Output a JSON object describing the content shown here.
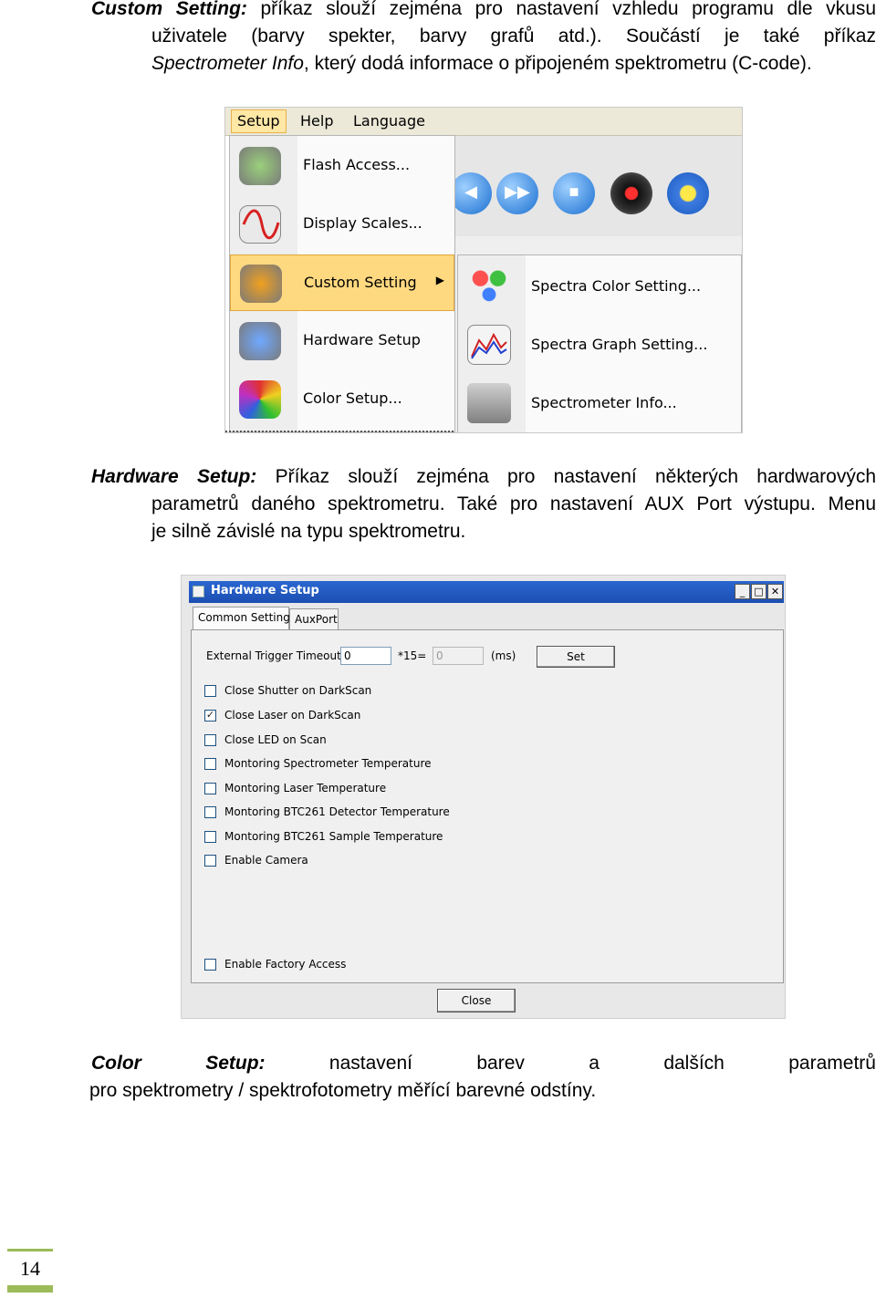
{
  "para1": {
    "lead": "Custom Setting:",
    "line1": "příkaz slouží zejména pro nastavení vzhledu programu dle vkusu",
    "line2": "uživatele (barvy spekter, barvy grafů atd.). Součástí je také příkaz",
    "line3_ital": "Spectrometer Info",
    "line3_rest": ", který dodá informace o připojeném spektrometru (C-code)."
  },
  "menu_shot": {
    "menubar": [
      "Setup",
      "Help",
      "Language"
    ],
    "items": [
      "Flash Access...",
      "Display Scales...",
      "Custom Setting",
      "Hardware Setup",
      "Color Setup..."
    ],
    "submenu": [
      "Spectra Color Setting...",
      "Spectra Graph Setting...",
      "Spectrometer Info..."
    ]
  },
  "para2": {
    "lead": "Hardware Setup:",
    "line1": "Příkaz slouží zejména pro nastavení některých hardwarových",
    "line2": "parametrů daného spektrometru. Také pro nastavení AUX Port výstupu. Menu",
    "line3": "je silně závislé na typu spektrometru."
  },
  "dialog": {
    "title": "Hardware Setup",
    "tabs": [
      "Common Setting",
      "AuxPort"
    ],
    "timeout_label": "External Trigger Timeout:",
    "timeout_value": "0",
    "mult_label": "*15=",
    "ms_value": "0",
    "ms_unit": "(ms)",
    "set_button": "Set",
    "checkboxes": [
      {
        "label": "Close Shutter on DarkScan",
        "checked": false
      },
      {
        "label": "Close Laser on DarkScan",
        "checked": true
      },
      {
        "label": "Close LED on Scan",
        "checked": false
      },
      {
        "label": "Montoring Spectrometer Temperature",
        "checked": false
      },
      {
        "label": "Montoring Laser Temperature",
        "checked": false
      },
      {
        "label": "Montoring BTC261 Detector Temperature",
        "checked": false
      },
      {
        "label": "Montoring BTC261 Sample Temperature",
        "checked": false
      },
      {
        "label": "Enable Camera",
        "checked": false
      }
    ],
    "factory_label": "Enable Factory Access",
    "close_button": "Close"
  },
  "para3": {
    "words": [
      "Color",
      "Setup:",
      "nastavení",
      "barev",
      "a",
      "dalších",
      "parametrů"
    ],
    "line2": "pro spektrometry / spektrofotometry měřící barevné odstíny."
  },
  "page_number": "14"
}
